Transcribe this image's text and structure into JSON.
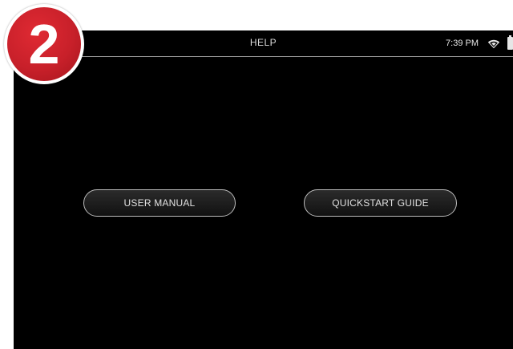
{
  "step_badge": {
    "number": "2",
    "color": "#c8202a"
  },
  "status_bar": {
    "title": "HELP",
    "time": "7:39 PM",
    "icons": [
      "wifi-icon",
      "battery-icon"
    ]
  },
  "main": {
    "buttons": [
      {
        "label": "USER MANUAL"
      },
      {
        "label": "QUICKSTART GUIDE"
      }
    ]
  }
}
